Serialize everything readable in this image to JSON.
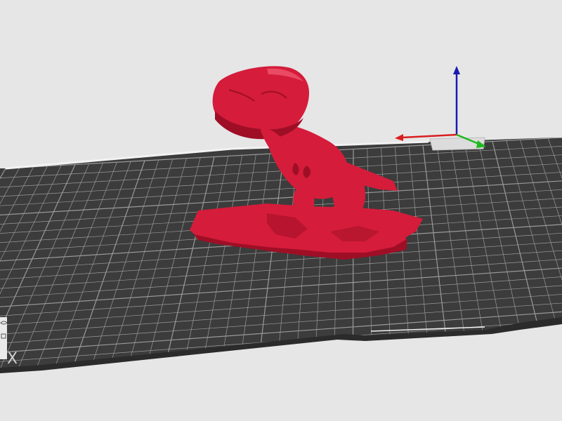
{
  "app": {
    "view": "3d-build-plate",
    "background_color": "#e6e6e6"
  },
  "bed": {
    "surface_color": "#3c3c3c",
    "grid_color": "#9a9a9a",
    "rim_color": "#2b2b2b",
    "edge_highlight_color": "#f2f2f2",
    "corner_glyph": "X"
  },
  "model": {
    "name": "t-rex",
    "color": "#d51c3b",
    "shadow_color": "#9e0f26",
    "highlight_color": "#ea4a63"
  },
  "axes": {
    "x_color": "#d91e1e",
    "y_color": "#1fb81f",
    "z_color": "#1a1ab0"
  },
  "icons": [
    "eye-icon",
    "cube-icon",
    "x-icon"
  ]
}
